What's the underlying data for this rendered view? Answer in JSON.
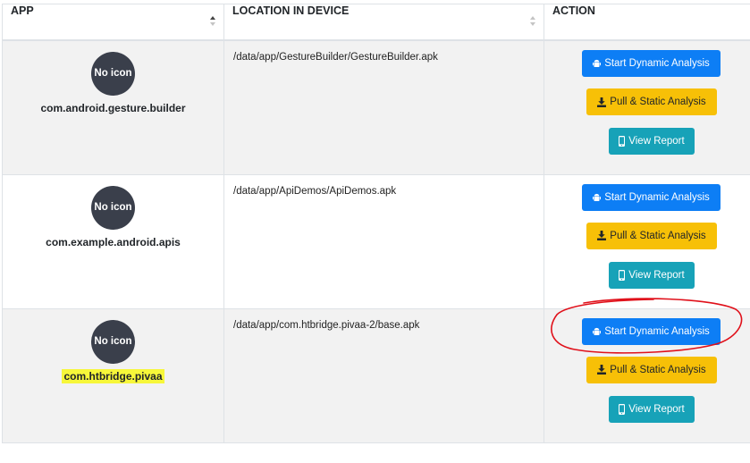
{
  "table": {
    "headers": {
      "app": "APP",
      "location": "LOCATION IN DEVICE",
      "action": "ACTION"
    },
    "rows": [
      {
        "icon_text": "No icon",
        "package": "com.android.gesture.builder",
        "location": "/data/app/GestureBuilder/GestureBuilder.apk"
      },
      {
        "icon_text": "No icon",
        "package": "com.example.android.apis",
        "location": "/data/app/ApiDemos/ApiDemos.apk"
      },
      {
        "icon_text": "No icon",
        "package": "com.htbridge.pivaa",
        "location": "/data/app/com.htbridge.pivaa-2/base.apk"
      }
    ],
    "actions": {
      "start_dynamic": "Start Dynamic Analysis",
      "pull_static": "Pull & Static Analysis",
      "view_report": "View Report"
    }
  },
  "colors": {
    "primary": "#0d7ef5",
    "warning": "#f7c007",
    "info": "#17a2b8",
    "highlight": "#f7f73a",
    "annotation": "#e0101a"
  },
  "icons": {
    "start_dynamic": "android-icon",
    "pull_static": "download-icon",
    "view_report": "mobile-icon"
  }
}
